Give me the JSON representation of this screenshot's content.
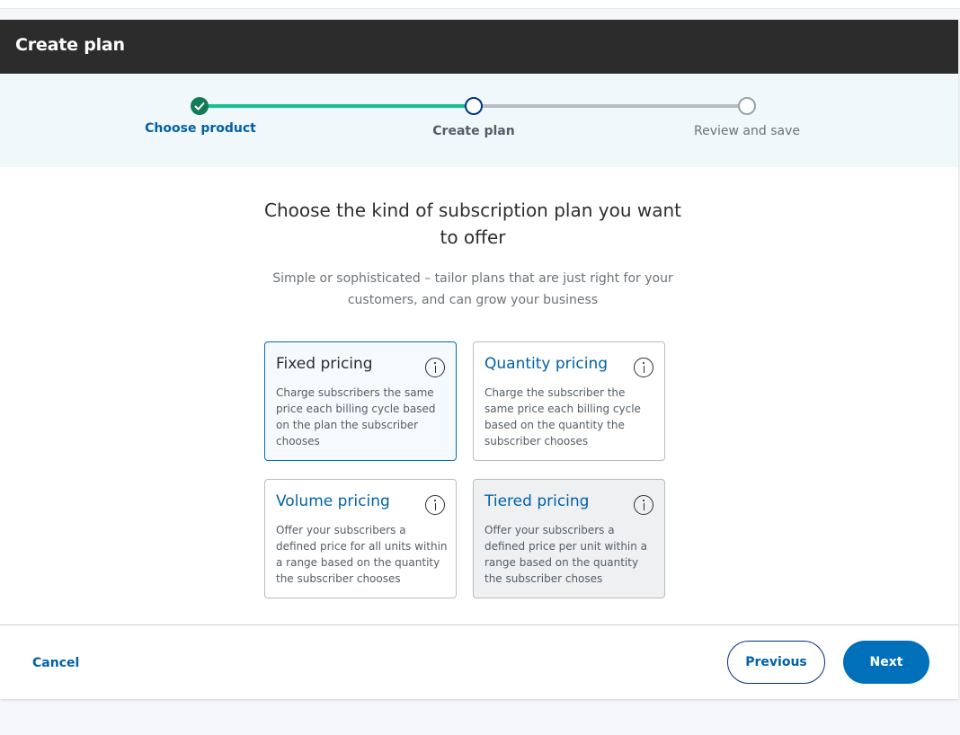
{
  "header": {
    "title": "Create plan"
  },
  "stepper": {
    "steps": [
      {
        "label": "Choose product",
        "status": "complete"
      },
      {
        "label": "Create plan",
        "status": "current"
      },
      {
        "label": "Review and save",
        "status": "upcoming"
      }
    ],
    "colors": {
      "complete": "#12c28b",
      "upcoming": "#b9bcbf"
    }
  },
  "main": {
    "heading": "Choose the kind of subscription plan you want to offer",
    "subheading": "Simple or sophisticated – tailor plans that are just right for your customers, and can grow your business"
  },
  "plan_types": [
    {
      "title": "Fixed pricing",
      "description": "Charge subscribers the same price each billing cycle based on the plan the subscriber chooses",
      "selected": true,
      "icon": "info-icon"
    },
    {
      "title": "Quantity pricing",
      "description": "Charge the subscriber the same price each billing cycle based on the quantity the subscriber chooses",
      "selected": false,
      "icon": "info-icon"
    },
    {
      "title": "Volume pricing",
      "description": "Offer your subscribers a defined price for all units within a range based on the quantity the subscriber chooses",
      "selected": false,
      "icon": "info-icon"
    },
    {
      "title": "Tiered pricing",
      "description": "Offer your subscribers a defined price per unit within a range based on the quantity the subscriber choses",
      "selected": false,
      "icon": "info-icon"
    }
  ],
  "footer": {
    "cancel_label": "Cancel",
    "previous_label": "Previous",
    "next_label": "Next"
  },
  "colors": {
    "accent": "#0070ba",
    "header": "#2c2c2c",
    "link": "#0061a8"
  }
}
